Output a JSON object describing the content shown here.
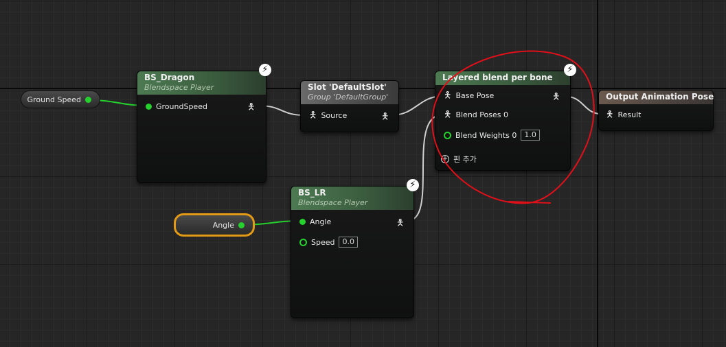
{
  "nodes": {
    "bs_dragon": {
      "title": "BS_Dragon",
      "subtitle": "Blendspace Player",
      "pin": "GroundSpeed"
    },
    "slot": {
      "title": "Slot 'DefaultSlot'",
      "subtitle": "Group 'DefaultGroup'",
      "pin": "Source"
    },
    "layered": {
      "title": "Layered blend per bone",
      "base_pose": "Base Pose",
      "blend_poses": "Blend Poses 0",
      "blend_weights": "Blend Weights 0",
      "blend_weights_value": "1.0",
      "add_pin": "핀 추가"
    },
    "output": {
      "title": "Output Animation Pose",
      "pin": "Result"
    },
    "bs_lr": {
      "title": "BS_LR",
      "subtitle": "Blendspace Player",
      "pin_angle": "Angle",
      "pin_speed": "Speed",
      "speed_value": "0.0"
    }
  },
  "variables": {
    "ground_speed": "Ground Speed",
    "angle": "Angle"
  },
  "icons": {
    "bolt": "lightning-icon",
    "pose": "pose-man-icon"
  },
  "colors": {
    "wire_float": "#25d12c",
    "wire_pose": "#cfcfcf",
    "annotation": "#e0101a",
    "selection": "#e39a14"
  }
}
